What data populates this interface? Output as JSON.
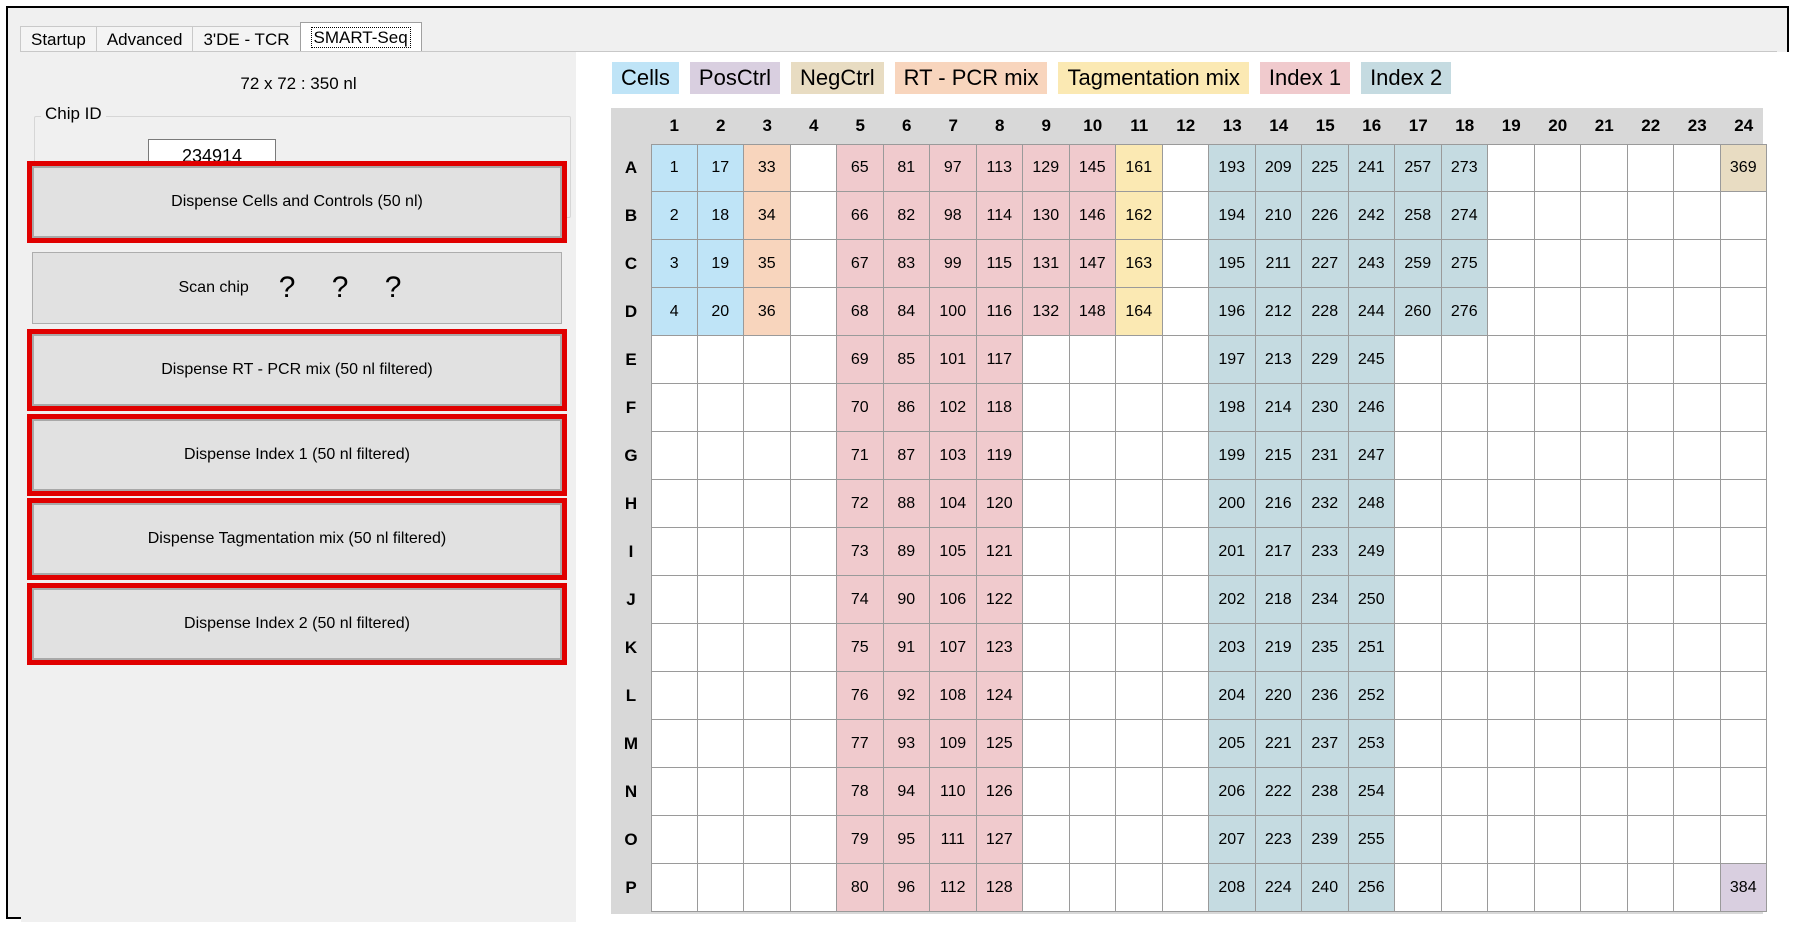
{
  "tabs": [
    {
      "label": "Startup",
      "active": false
    },
    {
      "label": "Advanced",
      "active": false
    },
    {
      "label": "3'DE - TCR",
      "active": false
    },
    {
      "label": "SMART-Seq",
      "active": true
    }
  ],
  "chip": {
    "size_label": "72 x 72 : 350 nl",
    "group_label": "Chip ID",
    "id_value": "234914"
  },
  "buttons": [
    {
      "name": "dispense-cells-controls-button",
      "label": "Dispense Cells and Controls (50 nl)",
      "highlighted": true
    },
    {
      "name": "scan-chip-button",
      "label": "Scan chip",
      "suffix": "? ? ?",
      "highlighted": false
    },
    {
      "name": "dispense-rt-pcr-button",
      "label": "Dispense RT - PCR mix (50 nl filtered)",
      "highlighted": true
    },
    {
      "name": "dispense-index1-button",
      "label": "Dispense Index 1 (50 nl filtered)",
      "highlighted": true
    },
    {
      "name": "dispense-tagmentation-button",
      "label": "Dispense Tagmentation mix (50 nl filtered)",
      "highlighted": true
    },
    {
      "name": "dispense-index2-button",
      "label": "Dispense Index 2 (50 nl filtered)",
      "highlighted": true
    }
  ],
  "legend": [
    {
      "key": "cells",
      "label": "Cells",
      "color": "#bfe4f7"
    },
    {
      "key": "posctrl",
      "label": "PosCtrl",
      "color": "#d9cfe0"
    },
    {
      "key": "negctrl",
      "label": "NegCtrl",
      "color": "#e8dcc2"
    },
    {
      "key": "rtpcr",
      "label": "RT - PCR mix",
      "color": "#f8d5bd"
    },
    {
      "key": "tag",
      "label": "Tagmentation mix",
      "color": "#fbe9b3"
    },
    {
      "key": "index1",
      "label": "Index 1",
      "color": "#f0cacd"
    },
    {
      "key": "index2",
      "label": "Index 2",
      "color": "#c5dbe1"
    }
  ],
  "plate": {
    "columns": [
      "1",
      "2",
      "3",
      "4",
      "5",
      "6",
      "7",
      "8",
      "9",
      "10",
      "11",
      "12",
      "13",
      "14",
      "15",
      "16",
      "17",
      "18",
      "19",
      "20",
      "21",
      "22",
      "23",
      "24"
    ],
    "rows": [
      "A",
      "B",
      "C",
      "D",
      "E",
      "F",
      "G",
      "H",
      "I",
      "J",
      "K",
      "L",
      "M",
      "N",
      "O",
      "P"
    ],
    "cells": [
      [
        "1",
        "17",
        "33",
        "",
        "65",
        "81",
        "97",
        "113",
        "129",
        "145",
        "161",
        "",
        "193",
        "209",
        "225",
        "241",
        "257",
        "273",
        "",
        "",
        "",
        "",
        "",
        "369"
      ],
      [
        "2",
        "18",
        "34",
        "",
        "66",
        "82",
        "98",
        "114",
        "130",
        "146",
        "162",
        "",
        "194",
        "210",
        "226",
        "242",
        "258",
        "274",
        "",
        "",
        "",
        "",
        "",
        ""
      ],
      [
        "3",
        "19",
        "35",
        "",
        "67",
        "83",
        "99",
        "115",
        "131",
        "147",
        "163",
        "",
        "195",
        "211",
        "227",
        "243",
        "259",
        "275",
        "",
        "",
        "",
        "",
        "",
        ""
      ],
      [
        "4",
        "20",
        "36",
        "",
        "68",
        "84",
        "100",
        "116",
        "132",
        "148",
        "164",
        "",
        "196",
        "212",
        "228",
        "244",
        "260",
        "276",
        "",
        "",
        "",
        "",
        "",
        ""
      ],
      [
        "",
        "",
        "",
        "",
        "69",
        "85",
        "101",
        "117",
        "",
        "",
        "",
        "",
        "197",
        "213",
        "229",
        "245",
        "",
        "",
        "",
        "",
        "",
        "",
        "",
        ""
      ],
      [
        "",
        "",
        "",
        "",
        "70",
        "86",
        "102",
        "118",
        "",
        "",
        "",
        "",
        "198",
        "214",
        "230",
        "246",
        "",
        "",
        "",
        "",
        "",
        "",
        "",
        ""
      ],
      [
        "",
        "",
        "",
        "",
        "71",
        "87",
        "103",
        "119",
        "",
        "",
        "",
        "",
        "199",
        "215",
        "231",
        "247",
        "",
        "",
        "",
        "",
        "",
        "",
        "",
        ""
      ],
      [
        "",
        "",
        "",
        "",
        "72",
        "88",
        "104",
        "120",
        "",
        "",
        "",
        "",
        "200",
        "216",
        "232",
        "248",
        "",
        "",
        "",
        "",
        "",
        "",
        "",
        ""
      ],
      [
        "",
        "",
        "",
        "",
        "73",
        "89",
        "105",
        "121",
        "",
        "",
        "",
        "",
        "201",
        "217",
        "233",
        "249",
        "",
        "",
        "",
        "",
        "",
        "",
        "",
        ""
      ],
      [
        "",
        "",
        "",
        "",
        "74",
        "90",
        "106",
        "122",
        "",
        "",
        "",
        "",
        "202",
        "218",
        "234",
        "250",
        "",
        "",
        "",
        "",
        "",
        "",
        "",
        ""
      ],
      [
        "",
        "",
        "",
        "",
        "75",
        "91",
        "107",
        "123",
        "",
        "",
        "",
        "",
        "203",
        "219",
        "235",
        "251",
        "",
        "",
        "",
        "",
        "",
        "",
        "",
        ""
      ],
      [
        "",
        "",
        "",
        "",
        "76",
        "92",
        "108",
        "124",
        "",
        "",
        "",
        "",
        "204",
        "220",
        "236",
        "252",
        "",
        "",
        "",
        "",
        "",
        "",
        "",
        ""
      ],
      [
        "",
        "",
        "",
        "",
        "77",
        "93",
        "109",
        "125",
        "",
        "",
        "",
        "",
        "205",
        "221",
        "237",
        "253",
        "",
        "",
        "",
        "",
        "",
        "",
        "",
        ""
      ],
      [
        "",
        "",
        "",
        "",
        "78",
        "94",
        "110",
        "126",
        "",
        "",
        "",
        "",
        "206",
        "222",
        "238",
        "254",
        "",
        "",
        "",
        "",
        "",
        "",
        "",
        ""
      ],
      [
        "",
        "",
        "",
        "",
        "79",
        "95",
        "111",
        "127",
        "",
        "",
        "",
        "",
        "207",
        "223",
        "239",
        "255",
        "",
        "",
        "",
        "",
        "",
        "",
        "",
        ""
      ],
      [
        "",
        "",
        "",
        "",
        "80",
        "96",
        "112",
        "128",
        "",
        "",
        "",
        "",
        "208",
        "224",
        "240",
        "256",
        "",
        "",
        "",
        "",
        "",
        "",
        "",
        "384"
      ]
    ],
    "cell_types": [
      [
        "cells",
        "cells",
        "rtpcr",
        "",
        "index1",
        "index1",
        "index1",
        "index1",
        "index1",
        "index1",
        "tag",
        "",
        "index2",
        "index2",
        "index2",
        "index2",
        "index2",
        "index2",
        "",
        "",
        "",
        "",
        "",
        "negctrl"
      ],
      [
        "cells",
        "cells",
        "rtpcr",
        "",
        "index1",
        "index1",
        "index1",
        "index1",
        "index1",
        "index1",
        "tag",
        "",
        "index2",
        "index2",
        "index2",
        "index2",
        "index2",
        "index2",
        "",
        "",
        "",
        "",
        "",
        ""
      ],
      [
        "cells",
        "cells",
        "rtpcr",
        "",
        "index1",
        "index1",
        "index1",
        "index1",
        "index1",
        "index1",
        "tag",
        "",
        "index2",
        "index2",
        "index2",
        "index2",
        "index2",
        "index2",
        "",
        "",
        "",
        "",
        "",
        ""
      ],
      [
        "cells",
        "cells",
        "rtpcr",
        "",
        "index1",
        "index1",
        "index1",
        "index1",
        "index1",
        "index1",
        "tag",
        "",
        "index2",
        "index2",
        "index2",
        "index2",
        "index2",
        "index2",
        "",
        "",
        "",
        "",
        "",
        ""
      ],
      [
        "",
        "",
        "",
        "",
        "index1",
        "index1",
        "index1",
        "index1",
        "",
        "",
        "",
        "",
        "index2",
        "index2",
        "index2",
        "index2",
        "",
        "",
        "",
        "",
        "",
        "",
        "",
        ""
      ],
      [
        "",
        "",
        "",
        "",
        "index1",
        "index1",
        "index1",
        "index1",
        "",
        "",
        "",
        "",
        "index2",
        "index2",
        "index2",
        "index2",
        "",
        "",
        "",
        "",
        "",
        "",
        "",
        ""
      ],
      [
        "",
        "",
        "",
        "",
        "index1",
        "index1",
        "index1",
        "index1",
        "",
        "",
        "",
        "",
        "index2",
        "index2",
        "index2",
        "index2",
        "",
        "",
        "",
        "",
        "",
        "",
        "",
        ""
      ],
      [
        "",
        "",
        "",
        "",
        "index1",
        "index1",
        "index1",
        "index1",
        "",
        "",
        "",
        "",
        "index2",
        "index2",
        "index2",
        "index2",
        "",
        "",
        "",
        "",
        "",
        "",
        "",
        ""
      ],
      [
        "",
        "",
        "",
        "",
        "index1",
        "index1",
        "index1",
        "index1",
        "",
        "",
        "",
        "",
        "index2",
        "index2",
        "index2",
        "index2",
        "",
        "",
        "",
        "",
        "",
        "",
        "",
        ""
      ],
      [
        "",
        "",
        "",
        "",
        "index1",
        "index1",
        "index1",
        "index1",
        "",
        "",
        "",
        "",
        "index2",
        "index2",
        "index2",
        "index2",
        "",
        "",
        "",
        "",
        "",
        "",
        "",
        ""
      ],
      [
        "",
        "",
        "",
        "",
        "index1",
        "index1",
        "index1",
        "index1",
        "",
        "",
        "",
        "",
        "index2",
        "index2",
        "index2",
        "index2",
        "",
        "",
        "",
        "",
        "",
        "",
        "",
        ""
      ],
      [
        "",
        "",
        "",
        "",
        "index1",
        "index1",
        "index1",
        "index1",
        "",
        "",
        "",
        "",
        "index2",
        "index2",
        "index2",
        "index2",
        "",
        "",
        "",
        "",
        "",
        "",
        "",
        ""
      ],
      [
        "",
        "",
        "",
        "",
        "index1",
        "index1",
        "index1",
        "index1",
        "",
        "",
        "",
        "",
        "index2",
        "index2",
        "index2",
        "index2",
        "",
        "",
        "",
        "",
        "",
        "",
        "",
        ""
      ],
      [
        "",
        "",
        "",
        "",
        "index1",
        "index1",
        "index1",
        "index1",
        "",
        "",
        "",
        "",
        "index2",
        "index2",
        "index2",
        "index2",
        "",
        "",
        "",
        "",
        "",
        "",
        "",
        ""
      ],
      [
        "",
        "",
        "",
        "",
        "index1",
        "index1",
        "index1",
        "index1",
        "",
        "",
        "",
        "",
        "index2",
        "index2",
        "index2",
        "index2",
        "",
        "",
        "",
        "",
        "",
        "",
        "",
        ""
      ],
      [
        "",
        "",
        "",
        "",
        "index1",
        "index1",
        "index1",
        "index1",
        "",
        "",
        "",
        "",
        "index2",
        "index2",
        "index2",
        "index2",
        "",
        "",
        "",
        "",
        "",
        "",
        "",
        "posctrl"
      ]
    ]
  }
}
